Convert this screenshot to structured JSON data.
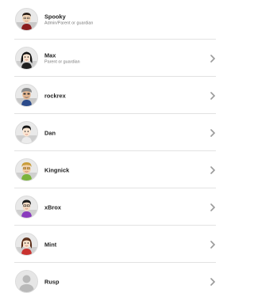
{
  "users": [
    {
      "name": "Spooky",
      "role": "Admin/Parent or guardian",
      "avatar": "mii-avatar-spooky",
      "chevron": false
    },
    {
      "name": "Max",
      "role": "Parent or guardian",
      "avatar": "mii-avatar-max",
      "chevron": true
    },
    {
      "name": "rockrex",
      "role": "",
      "avatar": "mii-avatar-rockrex",
      "chevron": true
    },
    {
      "name": "Dan",
      "role": "",
      "avatar": "mii-avatar-dan",
      "chevron": true
    },
    {
      "name": "Kingnick",
      "role": "",
      "avatar": "mii-avatar-kingnick",
      "chevron": true
    },
    {
      "name": "xBrox",
      "role": "",
      "avatar": "mii-avatar-xbrox",
      "chevron": true
    },
    {
      "name": "Mint",
      "role": "",
      "avatar": "mii-avatar-mint",
      "chevron": true
    },
    {
      "name": "Rusp",
      "role": "",
      "avatar": "default-user-avatar",
      "chevron": true
    }
  ],
  "colors": {
    "chevron": "#9a9a9a",
    "divider": "#e2e2e2",
    "avatar_bg": "#e9e9e9",
    "default_avatar": "#b9b9b9"
  }
}
